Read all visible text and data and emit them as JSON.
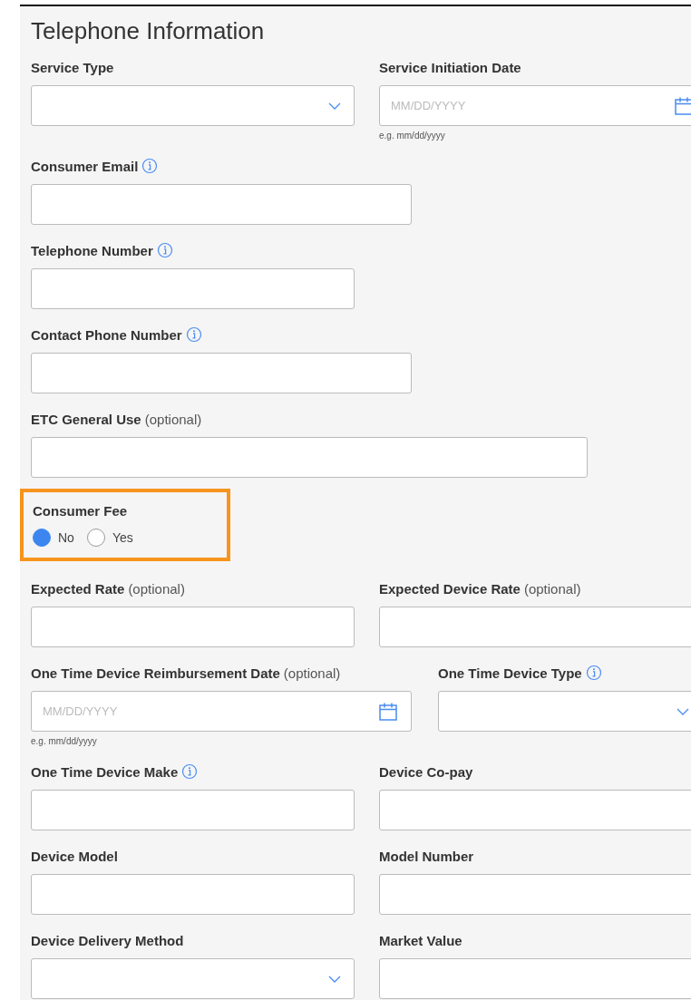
{
  "section": {
    "title": "Telephone Information"
  },
  "rows": [
    {
      "fields": [
        {
          "kind": "select",
          "label": "Service Type"
        },
        {
          "kind": "date",
          "label": "Service Initiation Date",
          "placeholder": "MM/DD/YYYY",
          "hint": "e.g. mm/dd/yyyy"
        }
      ]
    },
    {
      "fields": [
        {
          "kind": "text",
          "label": "Consumer Email",
          "info": true,
          "wide": true
        }
      ]
    },
    {
      "fields": [
        {
          "kind": "text",
          "label": "Telephone Number",
          "info": true
        }
      ]
    },
    {
      "fields": [
        {
          "kind": "text",
          "label": "Contact Phone Number",
          "info": true,
          "wide": true
        }
      ]
    },
    {
      "fields": [
        {
          "kind": "text",
          "label": "ETC General Use",
          "note": "(optional)",
          "extra_wide": true
        }
      ]
    },
    {
      "fields": [
        {
          "kind": "radio",
          "label": "Consumer Fee",
          "highlighted": true,
          "options": [
            {
              "label": "No",
              "selected": true
            },
            {
              "label": "Yes",
              "selected": false
            }
          ]
        }
      ]
    },
    {
      "fields": [
        {
          "kind": "text",
          "label": "Expected Rate",
          "note": "(optional)"
        },
        {
          "kind": "text",
          "label": "Expected Device Rate",
          "note": "(optional)"
        }
      ]
    },
    {
      "fields": [
        {
          "kind": "date",
          "label": "One Time Device Reimbursement Date",
          "note": "(optional)",
          "placeholder": "MM/DD/YYYY",
          "hint": "e.g. mm/dd/yyyy",
          "wide": true
        },
        {
          "kind": "select",
          "label": "One Time Device Type",
          "info": true
        }
      ]
    },
    {
      "fields": [
        {
          "kind": "text",
          "label": "One Time Device Make",
          "info": true
        },
        {
          "kind": "text",
          "label": "Device Co-pay"
        }
      ]
    },
    {
      "fields": [
        {
          "kind": "text",
          "label": "Device Model"
        },
        {
          "kind": "text",
          "label": "Model Number"
        }
      ]
    },
    {
      "fields": [
        {
          "kind": "select",
          "label": "Device Delivery Method"
        },
        {
          "kind": "text",
          "label": "Market Value"
        }
      ]
    }
  ]
}
